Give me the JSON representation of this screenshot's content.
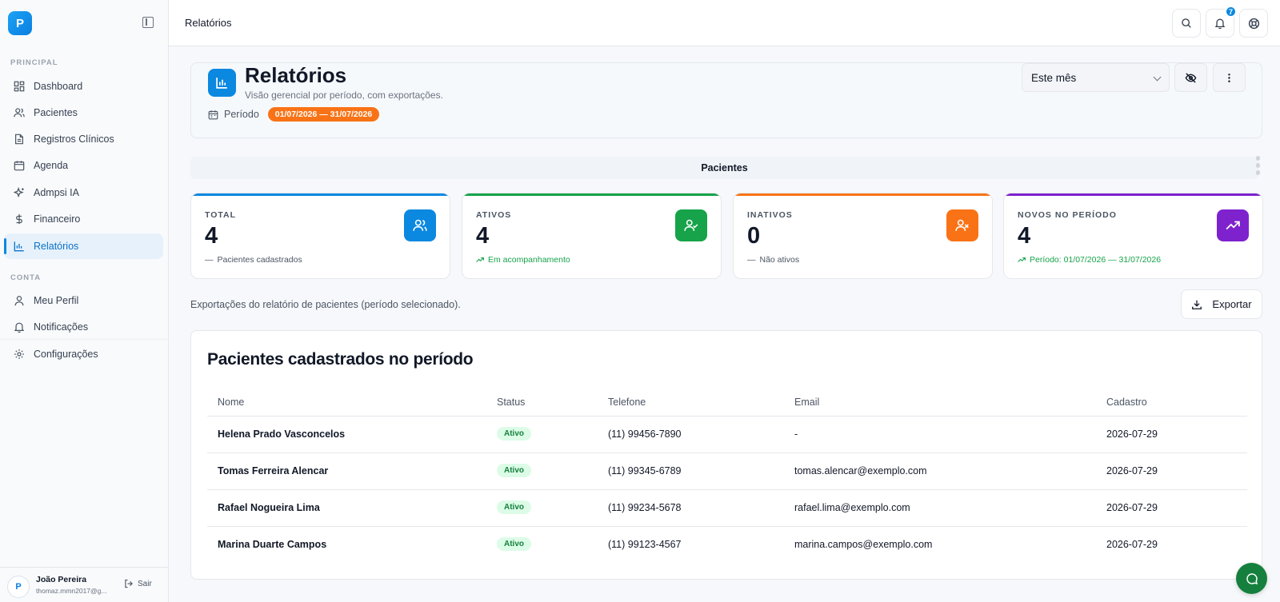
{
  "app": {
    "logo_text": "P"
  },
  "sidebar": {
    "section_principal": "PRINCIPAL",
    "section_conta": "CONTA",
    "items": [
      {
        "label": "Dashboard",
        "icon": "grid-icon"
      },
      {
        "label": "Pacientes",
        "icon": "users-icon"
      },
      {
        "label": "Registros Clínicos",
        "icon": "file-icon"
      },
      {
        "label": "Agenda",
        "icon": "calendar-icon"
      },
      {
        "label": "Admpsi IA",
        "icon": "sparkles-icon"
      },
      {
        "label": "Financeiro",
        "icon": "dollar-icon"
      },
      {
        "label": "Relatórios",
        "icon": "chart-icon",
        "active": true
      }
    ],
    "account_items": [
      {
        "label": "Meu Perfil",
        "icon": "user-icon"
      },
      {
        "label": "Notificações",
        "icon": "bell-icon"
      },
      {
        "label": "Configurações",
        "icon": "gear-icon"
      }
    ],
    "user": {
      "name": "João Pereira",
      "email": "thomaz.mmn2017@g...",
      "logout_label": "Sair"
    }
  },
  "topbar": {
    "title": "Relatórios",
    "notification_count": "7"
  },
  "header": {
    "title": "Relatórios",
    "subtitle": "Visão gerencial por período, com exportações.",
    "period_label": "Período",
    "period_value": "01/07/2026 — 31/07/2026",
    "range_select": "Este mês"
  },
  "tabs": [
    "Pacientes"
  ],
  "stats": [
    {
      "label": "TOTAL",
      "value": "4",
      "note": "Pacientes cadastrados",
      "color": "#0b88e0"
    },
    {
      "label": "ATIVOS",
      "value": "4",
      "note": "Em acompanhamento",
      "color": "#16a34a"
    },
    {
      "label": "INATIVOS",
      "value": "0",
      "note": "Não ativos",
      "color": "#f97316"
    },
    {
      "label": "NOVOS NO PERÍODO",
      "value": "4",
      "note": "Período: 01/07/2026 — 31/07/2026",
      "color": "#7e22ce"
    }
  ],
  "export": {
    "description": "Exportações do relatório de pacientes (período selecionado).",
    "button_label": "Exportar"
  },
  "table": {
    "title": "Pacientes cadastrados no período",
    "columns": [
      "Nome",
      "Status",
      "Telefone",
      "Email",
      "Cadastro"
    ],
    "rows": [
      {
        "name": "Helena Prado Vasconcelos",
        "status": "Ativo",
        "phone": "(11) 99456-7890",
        "email": "-",
        "date": "2026-07-29"
      },
      {
        "name": "Tomas Ferreira Alencar",
        "status": "Ativo",
        "phone": "(11) 99345-6789",
        "email": "tomas.alencar@exemplo.com",
        "date": "2026-07-29"
      },
      {
        "name": "Rafael Nogueira Lima",
        "status": "Ativo",
        "phone": "(11) 99234-5678",
        "email": "rafael.lima@exemplo.com",
        "date": "2026-07-29"
      },
      {
        "name": "Marina Duarte Campos",
        "status": "Ativo",
        "phone": "(11) 99123-4567",
        "email": "marina.campos@exemplo.com",
        "date": "2026-07-29"
      }
    ]
  },
  "colors": {
    "accent": "#0b88e0",
    "success": "#16a34a",
    "warning": "#f97316",
    "purple": "#7e22ce",
    "chat": "#15803d"
  }
}
